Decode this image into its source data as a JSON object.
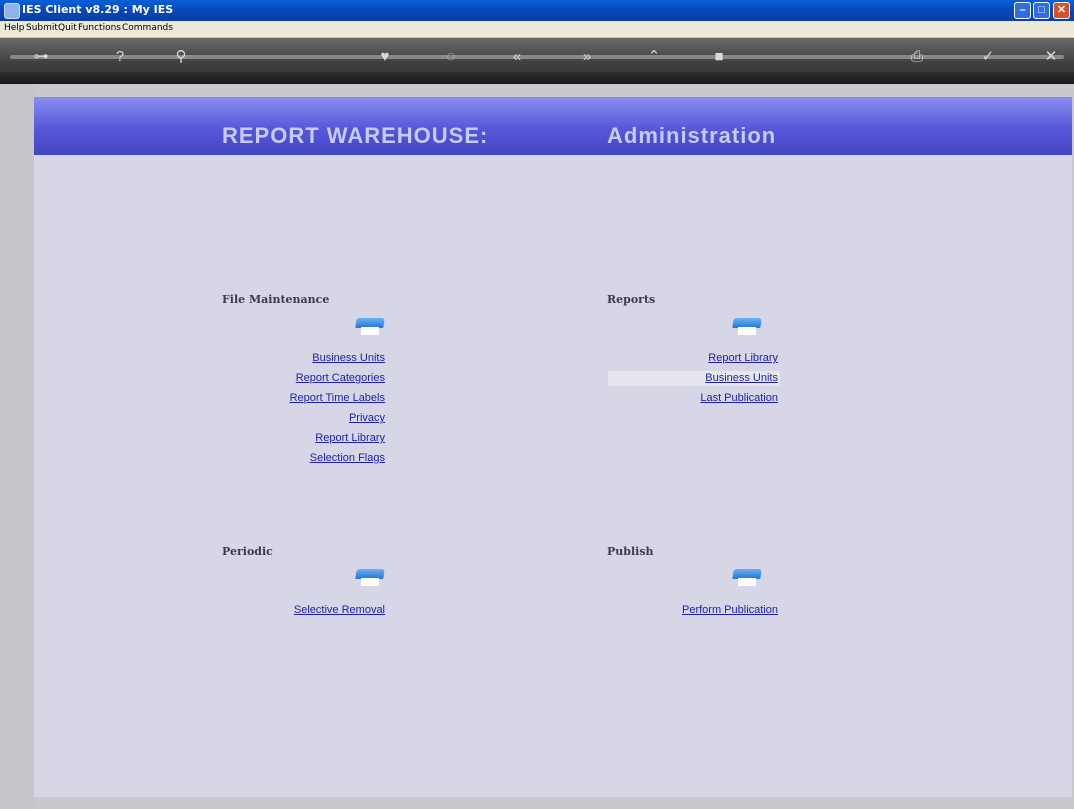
{
  "window": {
    "title": "IES Client v8.29 : My IES"
  },
  "menu": [
    "Help",
    "Submit",
    "Quit",
    "Functions",
    "Commands"
  ],
  "header": {
    "left": "REPORT WAREHOUSE:",
    "right": "Administration"
  },
  "sections": {
    "file_maintenance": {
      "title": "File Maintenance",
      "links": [
        "Business Units",
        "Report Categories",
        "Report Time Labels",
        "Privacy",
        "Report Library",
        "Selection Flags"
      ]
    },
    "reports": {
      "title": "Reports",
      "links": [
        "Report Library",
        "Business Units",
        "Last Publication"
      ]
    },
    "periodic": {
      "title": "Periodic",
      "links": [
        "Selective Removal"
      ]
    },
    "publish": {
      "title": "Publish",
      "links": [
        "Perform Publication"
      ]
    }
  },
  "colors": {
    "header_gradient_top": "#8a8ef0",
    "header_gradient_bottom": "#4246c4",
    "link": "#1f1faa",
    "content_bg": "#d6d6e6"
  },
  "icons": [
    "key-icon",
    "help-icon",
    "search-icon",
    "heart-icon",
    "refresh-icon",
    "rewind-icon",
    "forward-icon",
    "pin-icon",
    "stop-icon",
    "print-icon",
    "ok-icon",
    "cancel-icon"
  ]
}
